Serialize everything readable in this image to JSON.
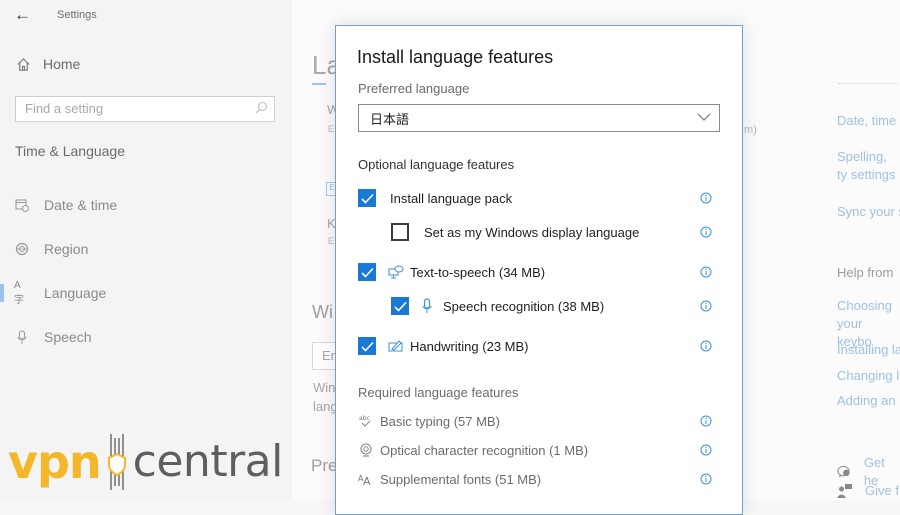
{
  "window": {
    "title": "Settings",
    "back_icon": "back-arrow-icon"
  },
  "sidebar": {
    "home_label": "Home",
    "search_placeholder": "Find a setting",
    "section_title": "Time & Language",
    "items": [
      {
        "label": "Date & time",
        "icon": "calendar-clock-icon",
        "active": false
      },
      {
        "label": "Region",
        "icon": "globe-icon",
        "active": false
      },
      {
        "label": "Language",
        "icon": "language-icon",
        "active": true
      },
      {
        "label": "Speech",
        "icon": "microphone-icon",
        "active": false
      }
    ]
  },
  "main_peek": {
    "title": "La",
    "line1": "W",
    "line1_sub": "E",
    "line2": "K",
    "line2_sub": "E",
    "tail_text": "m)",
    "section2": "Wi",
    "box_text": "Er",
    "line3": "Win",
    "line4": "lang",
    "section3": "Pre"
  },
  "right_panel": {
    "links_top": [
      "Date, time",
      "Spelling, ty settings",
      "Sync your s"
    ],
    "help_title": "Help from",
    "help_links": [
      "Choosing your keybo",
      "Installing la",
      "Changing l",
      "Adding an"
    ],
    "bottom_links": [
      {
        "label": "Get he",
        "icon": "get-help-icon"
      },
      {
        "label": "Give f",
        "icon": "feedback-icon"
      }
    ]
  },
  "dialog": {
    "title": "Install language features",
    "preferred_label": "Preferred language",
    "preferred_value": "日本語",
    "optional_title": "Optional language features",
    "optional": [
      {
        "label": "Install language pack",
        "checked": true,
        "indent": 0,
        "icon": null
      },
      {
        "label": "Set as my Windows display language",
        "checked": false,
        "indent": 1,
        "icon": null
      },
      {
        "label": "Text-to-speech (34 MB)",
        "checked": true,
        "indent": 0,
        "icon": "text-to-speech-icon"
      },
      {
        "label": "Speech recognition (38 MB)",
        "checked": true,
        "indent": 1,
        "icon": "microphone-icon"
      },
      {
        "label": "Handwriting (23 MB)",
        "checked": true,
        "indent": 0,
        "icon": "handwriting-icon"
      }
    ],
    "required_title": "Required language features",
    "required": [
      {
        "label": "Basic typing (57 MB)",
        "icon": "basic-typing-icon"
      },
      {
        "label": "Optical character recognition (1 MB)",
        "icon": "ocr-icon"
      },
      {
        "label": "Supplemental fonts (51 MB)",
        "icon": "fonts-icon"
      }
    ]
  },
  "watermark": {
    "part1": "vpn",
    "part2": "central"
  },
  "colors": {
    "accent": "#1979d4",
    "link": "#9ec1e3",
    "info_icon": "#3d8fd8",
    "watermark_yellow": "#f5b72a",
    "watermark_gray": "#5e5e5e"
  }
}
